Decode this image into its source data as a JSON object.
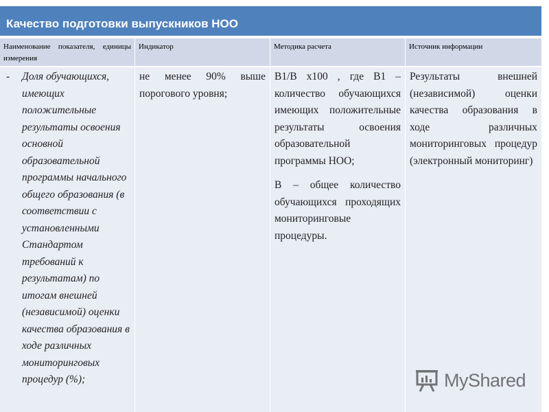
{
  "title": "Качество подготовки выпускников НОО",
  "table": {
    "headers": [
      "Наименование показателя, единицы измерения",
      "Индикатор",
      "Методика расчета",
      "Источник информации"
    ],
    "row": {
      "bullet": "-",
      "indicator_name": "Доля обучающихся, имеющих положительные результаты освоения основной образовательной программы начального общего образования (в соответствии с установленными Стандартом требований к результатам) по итогам внешней (независимой) оценки качества образования в ходе различных мониторинговых процедур (%);",
      "indicator": "не менее 90% выше порогового уровня;",
      "method_p1": "В1/В х100 , где В1 – количество обучающихся имеющих положительные результаты освоения образовательной программы НОО;",
      "method_p2": "В – общее количество обучающихся проходящих мониторинговые процедуры.",
      "source": "Результаты внешней (независимой) оценки качества образования в ходе различных мониторинговых процедур (электронный мониторинг)"
    }
  },
  "watermark": {
    "logo_text": "MyShared",
    "icon": "presentation-board-icon"
  },
  "colors": {
    "title_bg": "#4f81bd",
    "header_bg": "#d0d8e8",
    "cell_bg": "#e9edf4"
  }
}
